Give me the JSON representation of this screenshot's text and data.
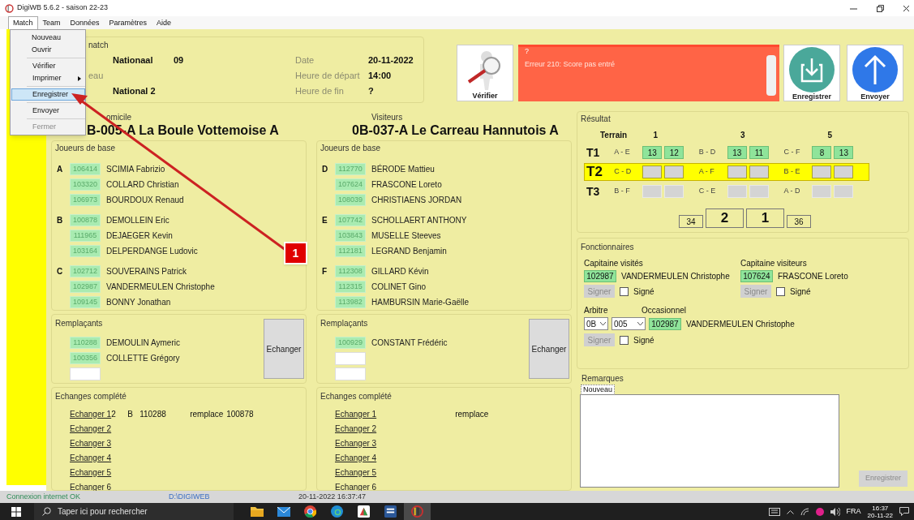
{
  "window": {
    "title": "DigiWB 5.6.2 - saison 22-23"
  },
  "menu_bar": [
    {
      "label": "Match",
      "selected": true
    },
    {
      "label": "Team",
      "selected": false
    },
    {
      "label": "Données",
      "selected": false
    },
    {
      "label": "Paramètres",
      "selected": false
    },
    {
      "label": "Aide",
      "selected": false
    }
  ],
  "open_menu": {
    "groups": [
      [
        {
          "label": "Nouveau",
          "selected": false,
          "disabled": false,
          "submenu": false
        },
        {
          "label": "Ouvrir",
          "selected": false,
          "disabled": false,
          "submenu": false
        }
      ],
      [
        {
          "label": "Vérifier",
          "selected": false,
          "disabled": false,
          "submenu": false
        },
        {
          "label": "Imprimer",
          "selected": false,
          "disabled": false,
          "submenu": true
        }
      ],
      [
        {
          "label": "Enregistrer",
          "selected": true,
          "disabled": false,
          "submenu": false
        }
      ],
      [
        {
          "label": "Envoyer",
          "selected": false,
          "disabled": false,
          "submenu": false
        }
      ],
      [
        {
          "label": "Fermer",
          "selected": false,
          "disabled": true,
          "submenu": false
        }
      ]
    ]
  },
  "match": {
    "group_label": "natch",
    "division": "Nationaal",
    "number": "09",
    "level_label": "eau",
    "series": "National 2",
    "fields": [
      {
        "label": "Date",
        "value": "20-11-2022"
      },
      {
        "label": "Heure de départ",
        "value": "14:00"
      },
      {
        "label": "Heure de fin",
        "value": "?"
      }
    ]
  },
  "toolbar": {
    "verify": "Vérifier",
    "error_box": {
      "title": "?",
      "message": "Erreur 210: Score pas entré"
    },
    "save": "Enregistrer",
    "send": "Envoyer"
  },
  "teams": [
    {
      "side_label": "omicile",
      "name": "B-005-A La Boule Vottemoise A",
      "base_label": "Joueurs de base",
      "groups": [
        {
          "letter": "A",
          "players": [
            {
              "id": "106414",
              "name": "SCIMIA Fabrizio"
            },
            {
              "id": "103320",
              "name": "COLLARD Christian"
            },
            {
              "id": "106973",
              "name": "BOURDOUX Renaud"
            }
          ]
        },
        {
          "letter": "B",
          "players": [
            {
              "id": "100878",
              "name": "DEMOLLEIN Eric"
            },
            {
              "id": "111965",
              "name": "DEJAEGER Kevin"
            },
            {
              "id": "103164",
              "name": "DELPERDANGE Ludovic"
            }
          ]
        },
        {
          "letter": "C",
          "players": [
            {
              "id": "102712",
              "name": "SOUVERAINS Patrick"
            },
            {
              "id": "102987",
              "name": "VANDERMEULEN Christophe"
            },
            {
              "id": "109145",
              "name": "BONNY Jonathan"
            }
          ]
        }
      ],
      "subs_label": "Remplaçants",
      "subs": [
        {
          "kind": "player",
          "id": "110288",
          "name": "DEMOULIN Aymeric"
        },
        {
          "kind": "player",
          "id": "100356",
          "name": "COLLETTE Grégory"
        },
        {
          "kind": "empty"
        }
      ],
      "swap_button": "Echanger",
      "exchanges_label": "Echanges complété",
      "exchanges": [
        {
          "link": "Echanger 1",
          "count": "2",
          "letter": "B",
          "in_id": "110288",
          "verb": "remplace",
          "out_id": "100878"
        },
        {
          "link": "Echanger 2"
        },
        {
          "link": "Echanger 3"
        },
        {
          "link": "Echanger 4"
        },
        {
          "link": "Echanger 5"
        },
        {
          "link": "Echanger 6"
        }
      ]
    },
    {
      "side_label": "Visiteurs",
      "name": "0B-037-A Le Carreau Hannutois A",
      "base_label": "Joueurs de base",
      "groups": [
        {
          "letter": "D",
          "players": [
            {
              "id": "112770",
              "name": "BÉRODE Mattieu"
            },
            {
              "id": "107624",
              "name": "FRASCONE Loreto"
            },
            {
              "id": "108039",
              "name": "CHRISTIAENS JORDAN"
            }
          ]
        },
        {
          "letter": "E",
          "players": [
            {
              "id": "107742",
              "name": "SCHOLLAERT ANTHONY"
            },
            {
              "id": "103843",
              "name": "MUSELLE Steeves"
            },
            {
              "id": "112181",
              "name": "LEGRAND Benjamin"
            }
          ]
        },
        {
          "letter": "F",
          "players": [
            {
              "id": "112308",
              "name": "GILLARD Kévin"
            },
            {
              "id": "112315",
              "name": "COLINET Gino"
            },
            {
              "id": "113982",
              "name": "HAMBURSIN Marie-Gaëlle"
            }
          ]
        }
      ],
      "subs_label": "Remplaçants",
      "subs": [
        {
          "kind": "player",
          "id": "100929",
          "name": "CONSTANT Frédéric"
        },
        {
          "kind": "empty"
        },
        {
          "kind": "empty"
        }
      ],
      "swap_button": "Echanger",
      "exchanges_label": "Echanges complété",
      "exchanges": [
        {
          "link": "Echanger 1",
          "verb": "remplace"
        },
        {
          "link": "Echanger 2"
        },
        {
          "link": "Echanger 3"
        },
        {
          "link": "Echanger 4"
        },
        {
          "link": "Echanger 5"
        },
        {
          "link": "Echanger 6"
        }
      ]
    }
  ],
  "result": {
    "label": "Résultat",
    "terrain_label": "Terrain",
    "terrains": [
      "1",
      "3",
      "5"
    ],
    "rounds": [
      {
        "name": "T1",
        "selected": false,
        "matches": [
          {
            "pair": "A - E",
            "played": true,
            "scores": [
              "13",
              "12"
            ]
          },
          {
            "pair": "B - D",
            "played": true,
            "scores": [
              "13",
              "11"
            ]
          },
          {
            "pair": "C - F",
            "played": true,
            "scores": [
              "8",
              "13"
            ]
          }
        ]
      },
      {
        "name": "T2",
        "selected": true,
        "matches": [
          {
            "pair": "C - D",
            "played": false
          },
          {
            "pair": "A - F",
            "played": false
          },
          {
            "pair": "B - E",
            "played": false
          }
        ]
      },
      {
        "name": "T3",
        "selected": false,
        "matches": [
          {
            "pair": "B - F",
            "played": false
          },
          {
            "pair": "C - E",
            "played": false
          },
          {
            "pair": "A - D",
            "played": false
          }
        ]
      }
    ],
    "totals": {
      "home_points": "34",
      "home_wins": "2",
      "away_wins": "1",
      "away_points": "36"
    }
  },
  "officials": {
    "label": "Fonctionnaires",
    "captains": [
      {
        "label": "Capitaine visités",
        "id": "102987",
        "name": "VANDERMEULEN Christophe",
        "sign_button": "Signer",
        "disabled": true,
        "signed_label": "Signé",
        "signed": false
      },
      {
        "label": "Capitaine visiteurs",
        "id": "107624",
        "name": "FRASCONE Loreto",
        "sign_button": "Signer",
        "disabled": true,
        "signed_label": "Signé",
        "signed": false
      }
    ],
    "referee": {
      "label": "Arbitre",
      "occasional_label": "Occasionnel",
      "region": "0B",
      "club": "005",
      "id": "102987",
      "name": "VANDERMEULEN Christophe",
      "sign_button": "Signer",
      "disabled": true,
      "signed_label": "Signé",
      "signed": false
    }
  },
  "remarks": {
    "label": "Remarques",
    "tab": "Nouveau",
    "save_button": "Enregistrer",
    "disabled": true
  },
  "status_bar": [
    {
      "kind": "connection",
      "text": "Connexion internet OK"
    },
    {
      "kind": "path",
      "text": "D:\\DIGIWEB"
    },
    {
      "kind": "timestamp",
      "text": "20-11-2022 16:37:47"
    }
  ],
  "annotation": {
    "label": "1"
  },
  "taskbar": {
    "search_placeholder": "Taper ici pour rechercher",
    "apps": [
      {
        "kind": "folder",
        "selected": false
      },
      {
        "kind": "mail",
        "selected": false
      },
      {
        "kind": "browser",
        "selected": false
      },
      {
        "kind": "edge",
        "selected": false
      },
      {
        "kind": "store",
        "selected": false
      },
      {
        "kind": "word",
        "selected": false
      },
      {
        "kind": "digiwb",
        "selected": true
      }
    ],
    "language": "FRA",
    "time": "16:37",
    "date": "20-11-22"
  }
}
